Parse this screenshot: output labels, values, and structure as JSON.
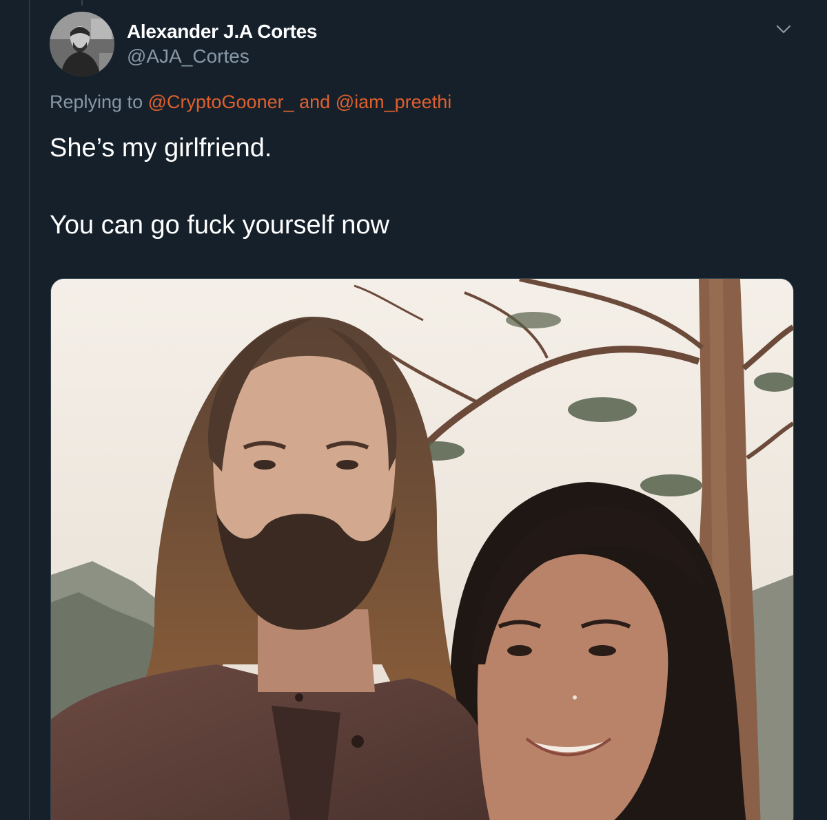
{
  "tweet": {
    "author_name": "Alexander J.A Cortes",
    "author_handle": "@AJA_Cortes",
    "replying_prefix": "Replying to",
    "reply_mention_1": "@CryptoGooner_",
    "reply_joiner": "and",
    "reply_mention_2": "@iam_preethi",
    "text_line_1": "She’s my girlfriend.",
    "text_line_2": "You can go fuck yourself now"
  },
  "icons": {
    "menu": "chevron-down-icon",
    "avatar": "avatar"
  },
  "colors": {
    "background": "#15202b",
    "primary_text": "#ffffff",
    "secondary_text": "#8899a6",
    "mention": "#e0602d",
    "border": "#38444d"
  }
}
